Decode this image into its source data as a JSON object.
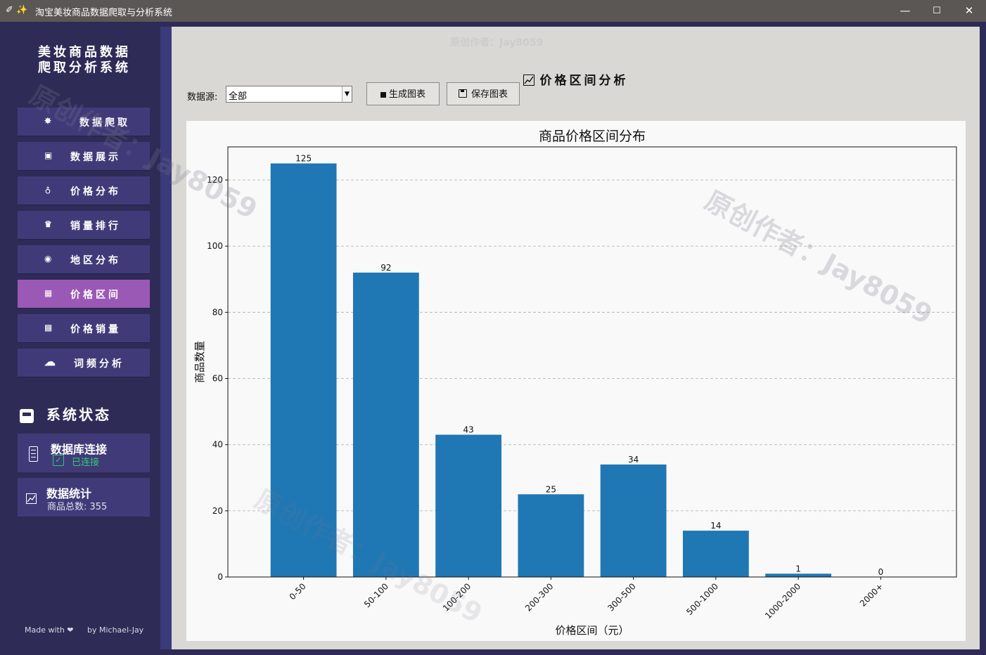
{
  "window": {
    "title": "淘宝美妆商品数据爬取与分析系统",
    "title_icons": "✐ ✨",
    "minimize": "—",
    "maximize": "☐",
    "close": "✕"
  },
  "sidebar": {
    "logo_line1": "美妆商品数据",
    "logo_line2": "爬取分析系统",
    "nav": [
      {
        "label": "数据爬取",
        "icon": "spider-icon",
        "glyph": "✵",
        "active": false
      },
      {
        "label": "数据展示",
        "icon": "package-icon",
        "glyph": "▣",
        "active": false
      },
      {
        "label": "价格分布",
        "icon": "money-bag-icon",
        "glyph": "♁",
        "active": false
      },
      {
        "label": "销量排行",
        "icon": "trophy-icon",
        "glyph": "♛",
        "active": false
      },
      {
        "label": "地区分布",
        "icon": "globe-icon",
        "glyph": "◉",
        "active": false
      },
      {
        "label": "价格区间",
        "icon": "chart-icon",
        "glyph": "▦",
        "active": true
      },
      {
        "label": "价格销量",
        "icon": "grid-chart-icon",
        "glyph": "▩",
        "active": false
      },
      {
        "label": "词频分析",
        "icon": "cloud-icon",
        "glyph": "☁",
        "active": false
      }
    ],
    "status_title": "系统状态",
    "db_title": "数据库连接",
    "db_status": "已连接",
    "db_check": "✓",
    "stats_title": "数据统计",
    "stats_text": "商品总数: 355",
    "footer_left": "Made with ❤",
    "footer_right": "by Michael-Jay",
    "colors": {
      "bg": "#2e2b57",
      "button": "#403b78",
      "active": "#9b59b6",
      "connected": "#2ecc71"
    }
  },
  "main": {
    "title": "价格区间分析",
    "title_icon": "chart-icon",
    "source_label": "数据源:",
    "source_value": "全部",
    "generate_button": "生成图表",
    "save_button": "保存图表"
  },
  "watermarks": [
    "原创作者：Jay8059",
    "原创作者：Jay8059",
    "原创作者：Jay8059",
    "原创作者：Jay8059"
  ],
  "chart_data": {
    "type": "bar",
    "title": "商品价格区间分布",
    "xlabel": "价格区间（元）",
    "ylabel": "商品数量",
    "categories": [
      "0-50",
      "50-100",
      "100-200",
      "200-300",
      "300-500",
      "500-1000",
      "1000-2000",
      "2000+"
    ],
    "values": [
      125,
      92,
      43,
      25,
      34,
      14,
      1,
      0
    ],
    "ylim": [
      0,
      130
    ],
    "yticks": [
      0,
      20,
      40,
      60,
      80,
      100,
      120
    ],
    "grid": true,
    "bar_color": "#1f77b4"
  }
}
